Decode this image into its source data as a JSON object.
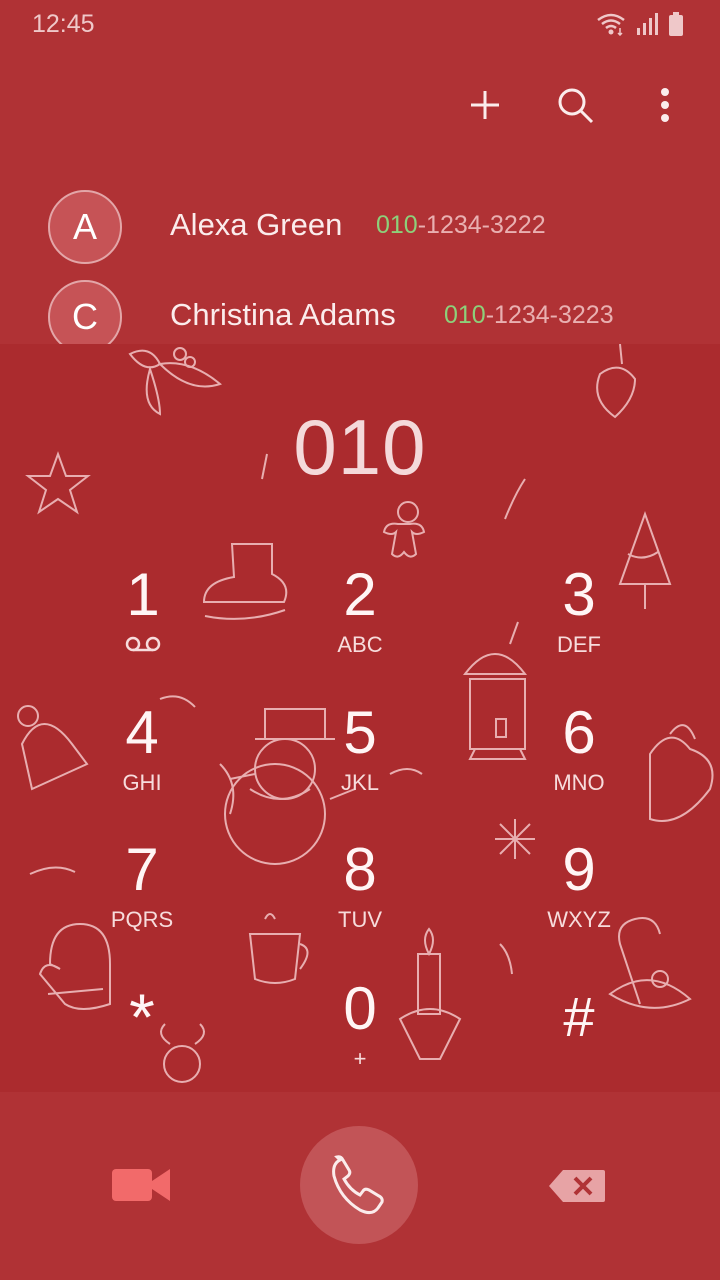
{
  "status_bar": {
    "time": "12:45"
  },
  "actions": [
    {
      "icon": "plus-icon"
    },
    {
      "icon": "search-icon"
    },
    {
      "icon": "more-vertical-icon"
    }
  ],
  "suggestions": [
    {
      "initial": "A",
      "name": "Alexa Green",
      "match": "010",
      "rest": "-1234-3222"
    },
    {
      "initial": "C",
      "name": "Christina Adams",
      "match": "010",
      "rest": "-1234-3223"
    }
  ],
  "dialed_number": "010",
  "keys": [
    {
      "digit": "1",
      "letters": ""
    },
    {
      "digit": "2",
      "letters": "ABC"
    },
    {
      "digit": "3",
      "letters": "DEF"
    },
    {
      "digit": "4",
      "letters": "GHI"
    },
    {
      "digit": "5",
      "letters": "JKL"
    },
    {
      "digit": "6",
      "letters": "MNO"
    },
    {
      "digit": "7",
      "letters": "PQRS"
    },
    {
      "digit": "8",
      "letters": "TUV"
    },
    {
      "digit": "9",
      "letters": "WXYZ"
    },
    {
      "digit": "*",
      "letters": ""
    },
    {
      "digit": "0",
      "letters": "+"
    },
    {
      "digit": "#",
      "letters": ""
    }
  ],
  "bottom_bar": {
    "video_call_icon": "video-camera-icon",
    "call_icon": "phone-icon",
    "backspace_icon": "backspace-icon"
  },
  "colors": {
    "theme": "#ad2d30",
    "match_highlight": "#8dd07a",
    "video_call": "#f26a6a"
  }
}
